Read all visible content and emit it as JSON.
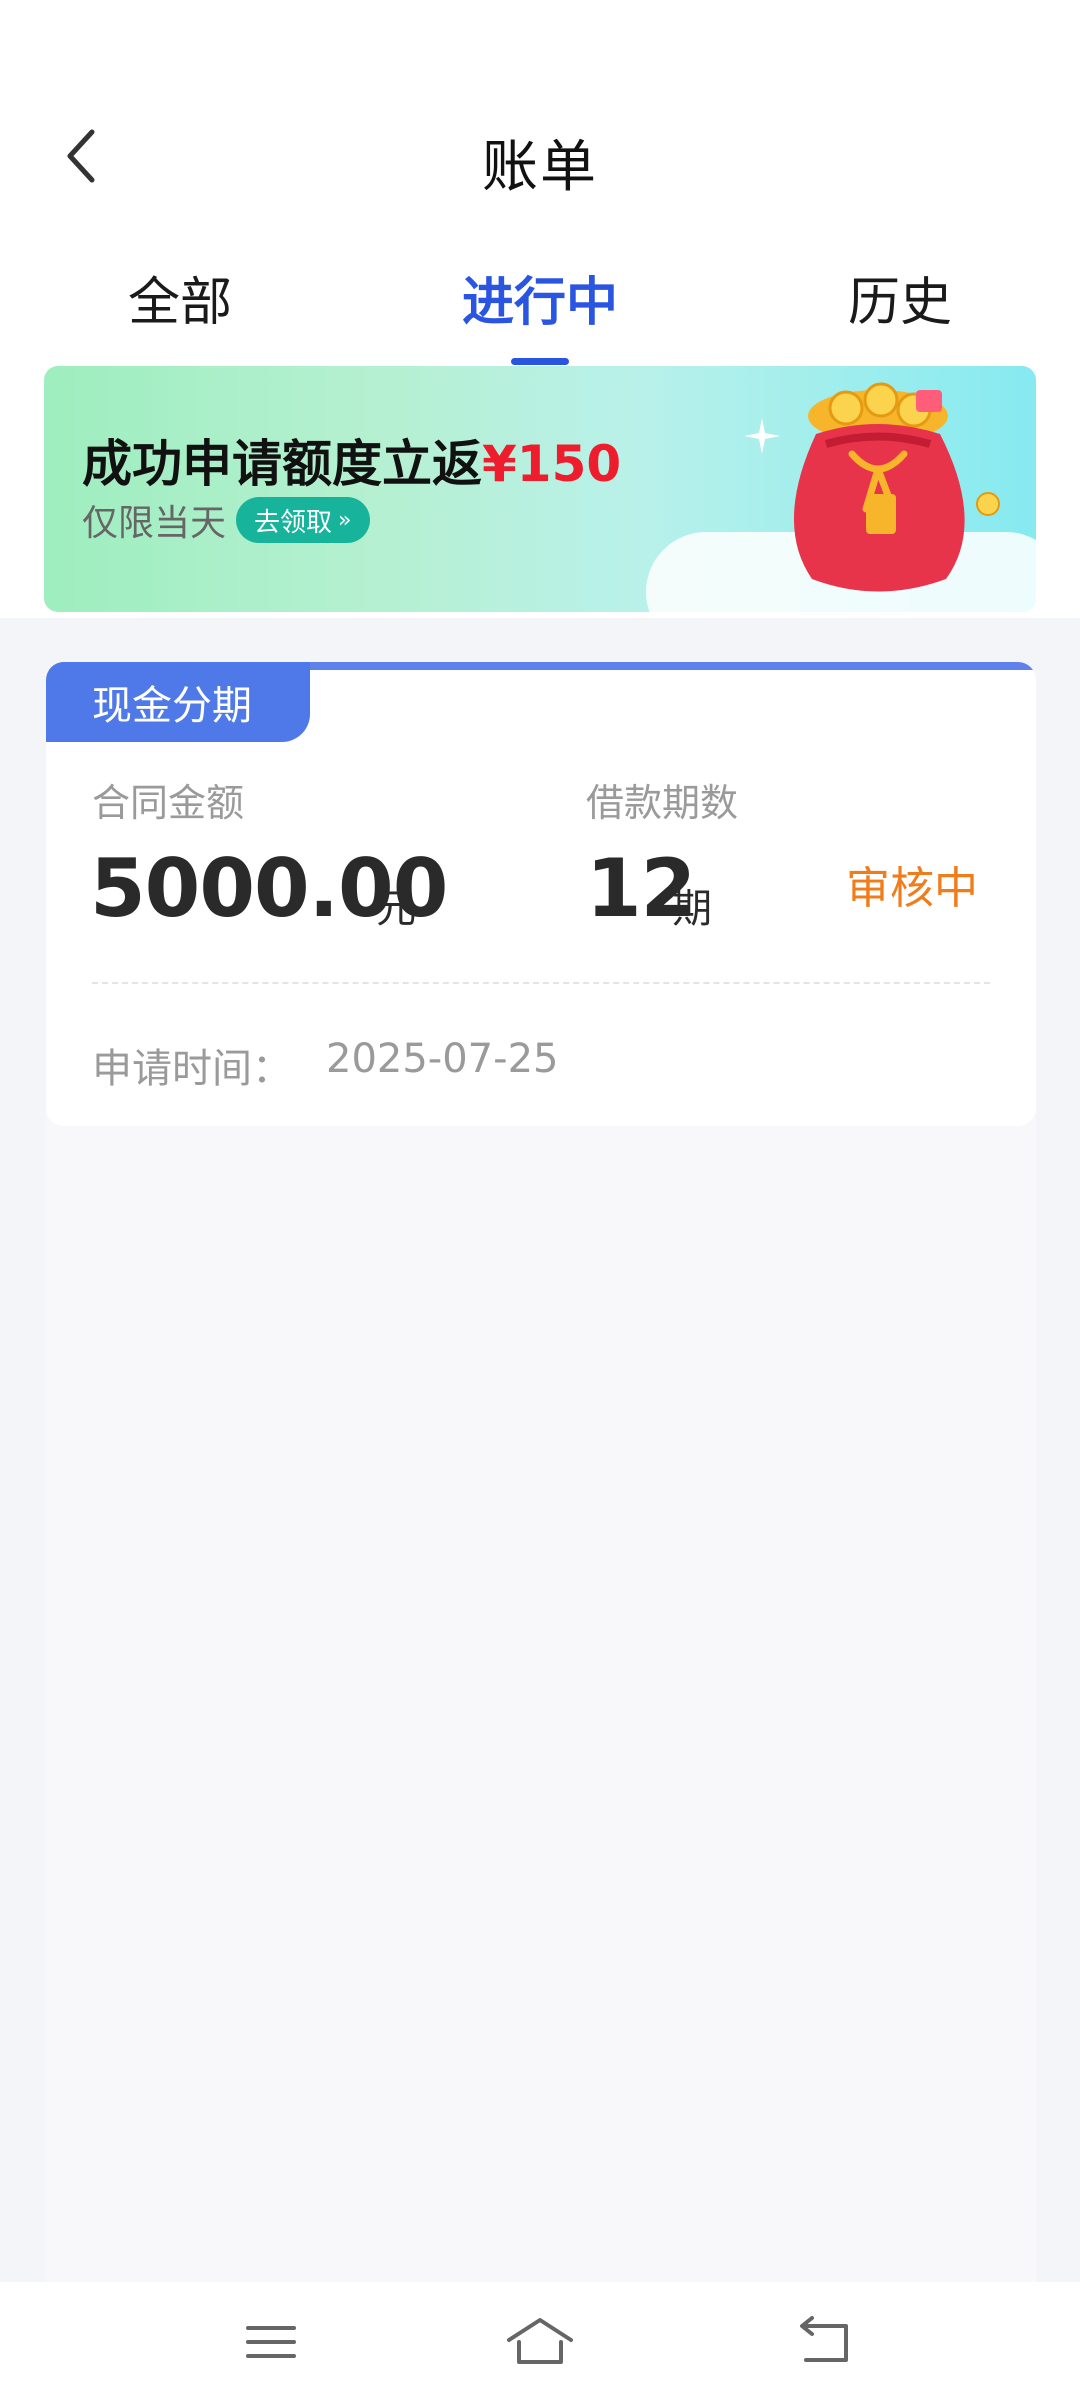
{
  "header": {
    "title": "账单",
    "back_icon": "chevron-left-icon"
  },
  "tabs": [
    {
      "label": "全部",
      "active": false
    },
    {
      "label": "进行中",
      "active": true
    },
    {
      "label": "历史",
      "active": false
    }
  ],
  "colors": {
    "accent": "#2a55e0",
    "status": "#f07d1c",
    "promo_red": "#ee1d2e",
    "claim_button": "#17b49b",
    "card_tag": "#4f78e8"
  },
  "banner": {
    "title_prefix": "成功申请额度立返",
    "title_amount": "¥150",
    "subtitle": "仅限当天",
    "button_label": "去领取",
    "image_icon": "money-bag-icon"
  },
  "card": {
    "tag": "现金分期",
    "amount_label": "合同金额",
    "amount_value": "5000.00",
    "amount_unit": "元",
    "term_label": "借款期数",
    "term_value": "12",
    "term_unit": "期",
    "status": "审核中",
    "apply_time_label": "申请时间：",
    "apply_time_value": "2025-07-25"
  },
  "navbar": {
    "icons": [
      "menu-icon",
      "home-icon",
      "back-icon"
    ]
  }
}
